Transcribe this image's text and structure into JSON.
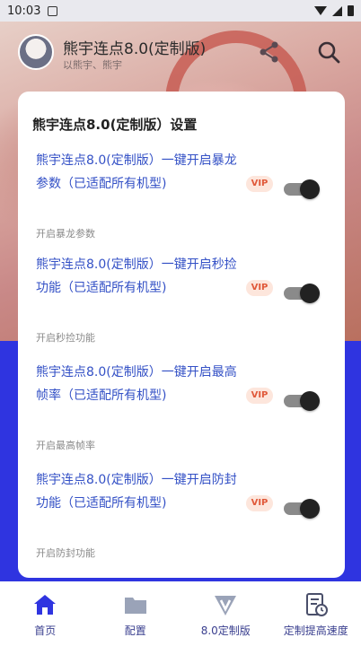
{
  "status_bar": {
    "time": "10:03"
  },
  "header": {
    "title": "熊宇连点8.0(定制版)",
    "subtitle": "以熊宇、熊宇"
  },
  "card": {
    "title": "熊宇连点8.0(定制版）设置",
    "items": [
      {
        "text": "熊宇连点8.0(定制版）一键开启暴龙参数（已适配所有机型)",
        "sub": "开启暴龙参数",
        "badge": "VIP",
        "enabled": true
      },
      {
        "text": "熊宇连点8.0(定制版）一键开启秒捡功能（已适配所有机型)",
        "sub": "开启秒捡功能",
        "badge": "VIP",
        "enabled": true
      },
      {
        "text": "熊宇连点8.0(定制版）一键开启最高帧率（已适配所有机型)",
        "sub": "开启最高帧率",
        "badge": "VIP",
        "enabled": true
      },
      {
        "text": "熊宇连点8.0(定制版）一键开启防封功能（已适配所有机型)",
        "sub": "开启防封功能",
        "badge": "VIP",
        "enabled": true
      }
    ]
  },
  "bottom_nav": {
    "items": [
      {
        "label": "首页",
        "icon": "home-icon"
      },
      {
        "label": "配置",
        "icon": "folder-icon"
      },
      {
        "label": "8.0定制版",
        "icon": "v-badge-icon"
      },
      {
        "label": "定制提高速度",
        "icon": "document-clock-icon"
      }
    ]
  },
  "colors": {
    "accent_blue": "#2f34e0",
    "item_text": "#3451c6",
    "vip_text": "#e0593a",
    "vip_bg": "#fde6dc"
  }
}
